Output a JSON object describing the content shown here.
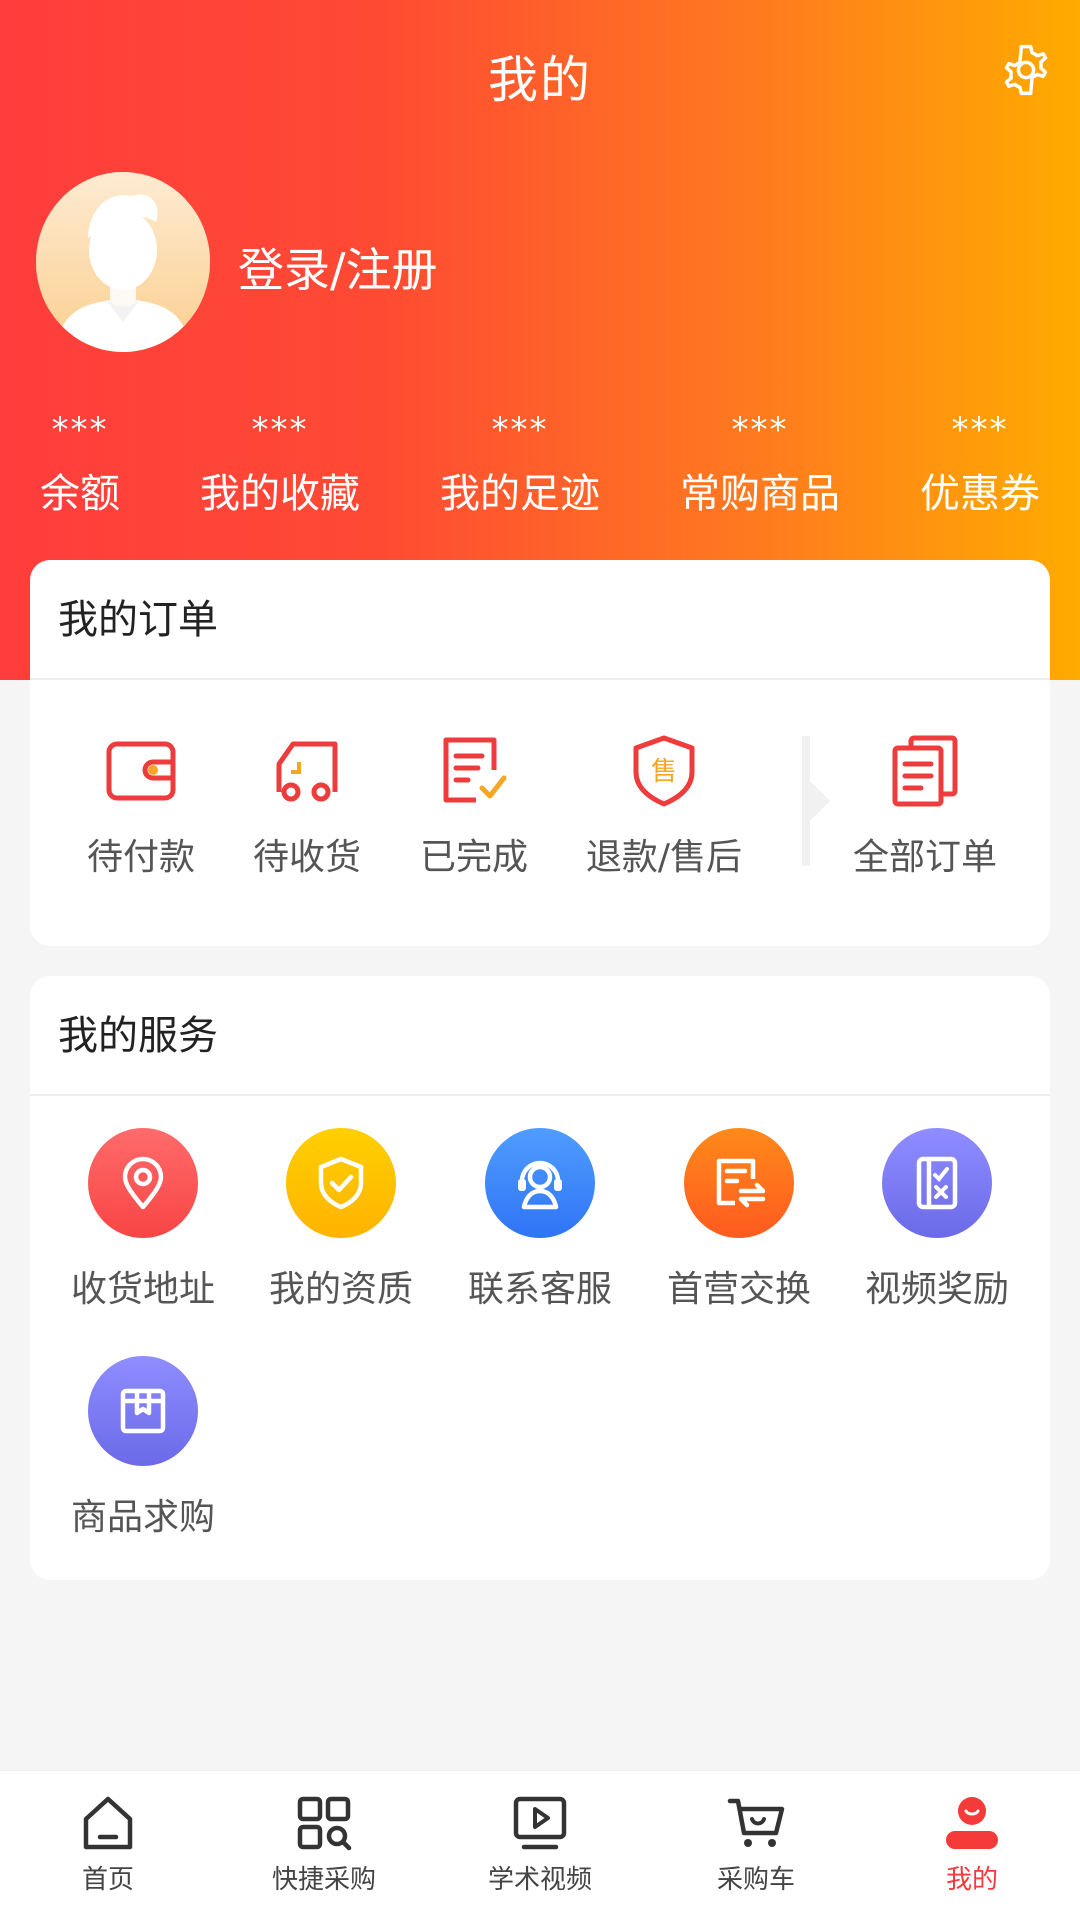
{
  "header": {
    "title": "我的",
    "login_label": "登录/注册"
  },
  "stats": [
    {
      "value": "***",
      "label": "余额"
    },
    {
      "value": "***",
      "label": "我的收藏"
    },
    {
      "value": "***",
      "label": "我的足迹"
    },
    {
      "value": "***",
      "label": "常购商品"
    },
    {
      "value": "***",
      "label": "优惠券"
    }
  ],
  "orders": {
    "title": "我的订单",
    "items": [
      {
        "label": "待付款",
        "icon": "wallet-icon"
      },
      {
        "label": "待收货",
        "icon": "truck-icon"
      },
      {
        "label": "已完成",
        "icon": "document-check-icon"
      },
      {
        "label": "退款/售后",
        "icon": "shield-sale-icon"
      },
      {
        "label": "全部订单",
        "icon": "orders-stack-icon"
      }
    ]
  },
  "services": {
    "title": "我的服务",
    "items": [
      {
        "label": "收货地址",
        "icon": "location-pin-icon"
      },
      {
        "label": "我的资质",
        "icon": "shield-check-icon"
      },
      {
        "label": "联系客服",
        "icon": "headset-icon"
      },
      {
        "label": "首营交换",
        "icon": "exchange-icon"
      },
      {
        "label": "视频奖励",
        "icon": "checklist-icon"
      },
      {
        "label": "商品求购",
        "icon": "package-icon"
      }
    ]
  },
  "tabbar": {
    "items": [
      {
        "label": "首页",
        "icon": "home-icon"
      },
      {
        "label": "快捷采购",
        "icon": "quick-purchase-icon"
      },
      {
        "label": "学术视频",
        "icon": "video-icon"
      },
      {
        "label": "采购车",
        "icon": "cart-icon"
      },
      {
        "label": "我的",
        "icon": "profile-icon",
        "active": true
      }
    ]
  },
  "colors": {
    "brand_red": "#f53a3a",
    "header_gradient_start": "#ff3d3d",
    "header_gradient_end": "#ffab00",
    "order_icon_red": "#ee3b3b",
    "order_icon_accent": "#f5a623"
  }
}
